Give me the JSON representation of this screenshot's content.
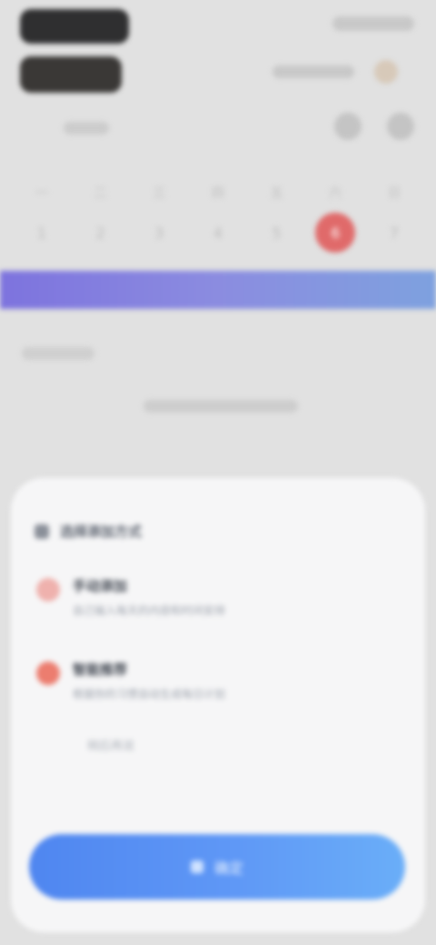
{
  "calendar": {
    "days": [
      {
        "weekday": "一",
        "date": "1",
        "active": false
      },
      {
        "weekday": "二",
        "date": "2",
        "active": false
      },
      {
        "weekday": "三",
        "date": "3",
        "active": false
      },
      {
        "weekday": "四",
        "date": "4",
        "active": false
      },
      {
        "weekday": "五",
        "date": "5",
        "active": false
      },
      {
        "weekday": "六",
        "date": "6",
        "active": true
      },
      {
        "weekday": "日",
        "date": "7",
        "active": false
      }
    ]
  },
  "sheet": {
    "title": "选择添加方式",
    "options": [
      {
        "title": "手动添加",
        "description": "自己输入每天的内容和时间安排",
        "icon_color": "#efb1ad"
      },
      {
        "title": "智能推荐",
        "description": "根据你的习惯自动生成每日计划",
        "icon_color": "#ec7d6f"
      }
    ],
    "plain_option": "稍后再说",
    "primary_button": "确定"
  },
  "colors": {
    "accent_blue": "#5f98f6",
    "banner_purple": "#7d73de",
    "active_day": "#e06a6a"
  }
}
